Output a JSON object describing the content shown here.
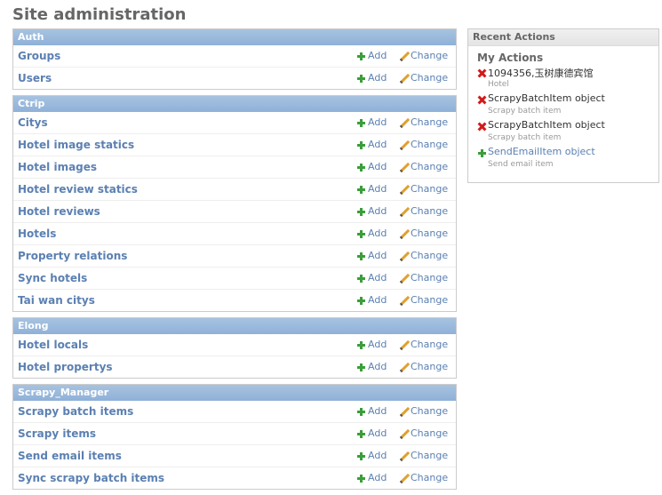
{
  "title": "Site administration",
  "actions": {
    "add_label": "Add",
    "change_label": "Change"
  },
  "modules": [
    {
      "caption": "Auth",
      "models": [
        "Groups",
        "Users"
      ]
    },
    {
      "caption": "Ctrip",
      "models": [
        "Citys",
        "Hotel image statics",
        "Hotel images",
        "Hotel review statics",
        "Hotel reviews",
        "Hotels",
        "Property relations",
        "Sync hotels",
        "Tai wan citys"
      ]
    },
    {
      "caption": "Elong",
      "models": [
        "Hotel locals",
        "Hotel propertys"
      ]
    },
    {
      "caption": "Scrapy_Manager",
      "models": [
        "Scrapy batch items",
        "Scrapy items",
        "Send email items",
        "Sync scrapy batch items"
      ]
    }
  ],
  "recent": {
    "caption": "Recent Actions",
    "subtitle": "My Actions",
    "items": [
      {
        "icon": "delete-icon",
        "title": "1094356,玉树康德宾馆",
        "type": "Hotel",
        "link": false
      },
      {
        "icon": "delete-icon",
        "title": "ScrapyBatchItem object",
        "type": "Scrapy batch item",
        "link": false
      },
      {
        "icon": "delete-icon",
        "title": "ScrapyBatchItem object",
        "type": "Scrapy batch item",
        "link": false
      },
      {
        "icon": "add-icon",
        "title": "SendEmailItem object",
        "type": "Send email item",
        "link": true
      }
    ]
  },
  "colors": {
    "link": "#5b80b2",
    "caption_bg": "#8fb1d8",
    "delete": "#d21a1a",
    "add": "#3a9e3a"
  }
}
